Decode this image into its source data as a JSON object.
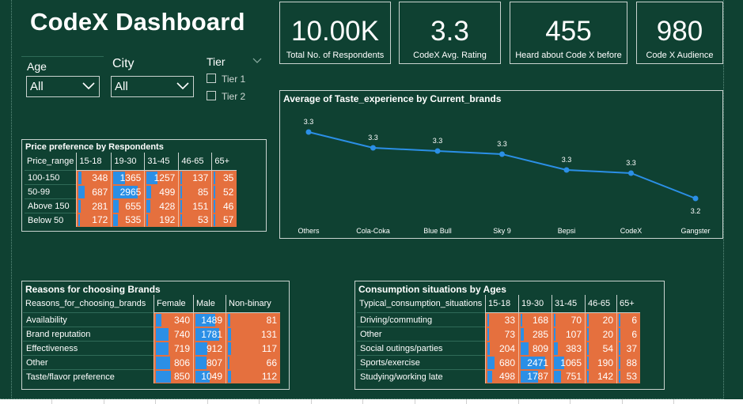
{
  "dashboard": {
    "title": "CodeX Dashboard"
  },
  "kpis": [
    {
      "value": "10.00K",
      "label": "Total No. of Respondents"
    },
    {
      "value": "3.3",
      "label": "CodeX Avg. Rating"
    },
    {
      "value": "455",
      "label": "Heard about Code X before"
    },
    {
      "value": "980",
      "label": "Code X Audience"
    }
  ],
  "filters": {
    "age": {
      "label": "Age",
      "selected": "All"
    },
    "city": {
      "label": "City",
      "selected": "All"
    },
    "tier": {
      "label": "Tier",
      "options": [
        "Tier 1",
        "Tier 2"
      ]
    }
  },
  "colors": {
    "background": "#0f4132",
    "cell_orange": "#e5703e",
    "bar_blue": "#2b8fe6",
    "line_blue": "#2b8fe6"
  },
  "price_table": {
    "title": "Price preference by Respondents",
    "columns": [
      "Price_range",
      "15-18",
      "19-30",
      "31-45",
      "46-65",
      "65+"
    ],
    "max": 2965,
    "rows": [
      {
        "label": "100-150",
        "values": [
          348,
          1365,
          1257,
          137,
          35
        ]
      },
      {
        "label": "50-99",
        "values": [
          687,
          2965,
          499,
          85,
          52
        ]
      },
      {
        "label": "Above 150",
        "values": [
          281,
          655,
          428,
          151,
          46
        ]
      },
      {
        "label": "Below 50",
        "values": [
          172,
          535,
          192,
          53,
          57
        ]
      }
    ]
  },
  "reasons_table": {
    "title": "Reasons for choosing Brands",
    "columns": [
      "Reasons_for_choosing_brands",
      "Female",
      "Male",
      "Non-binary"
    ],
    "max": 1781,
    "rows": [
      {
        "label": "Availability",
        "values": [
          340,
          1489,
          81
        ]
      },
      {
        "label": "Brand reputation",
        "values": [
          740,
          1781,
          131
        ]
      },
      {
        "label": "Effectiveness",
        "values": [
          719,
          912,
          117
        ]
      },
      {
        "label": "Other",
        "values": [
          806,
          807,
          66
        ]
      },
      {
        "label": "Taste/flavor preference",
        "values": [
          850,
          1049,
          112
        ]
      }
    ]
  },
  "consumption_table": {
    "title": "Consumption situations by Ages",
    "columns": [
      "Typical_consumption_situations",
      "15-18",
      "19-30",
      "31-45",
      "46-65",
      "65+"
    ],
    "max": 2471,
    "rows": [
      {
        "label": "Driving/commuting",
        "values": [
          33,
          168,
          70,
          20,
          6
        ]
      },
      {
        "label": "Other",
        "values": [
          73,
          285,
          107,
          20,
          6
        ]
      },
      {
        "label": "Social outings/parties",
        "values": [
          204,
          809,
          383,
          54,
          37
        ]
      },
      {
        "label": "Sports/exercise",
        "values": [
          680,
          2471,
          1065,
          190,
          88
        ]
      },
      {
        "label": "Studying/working late",
        "values": [
          498,
          1787,
          751,
          142,
          53
        ]
      }
    ]
  },
  "chart_data": {
    "type": "line",
    "title": "Average of Taste_experience by Current_brands",
    "categories": [
      "Others",
      "Cola-Coka",
      "Blue Bull",
      "Sky 9",
      "Bepsi",
      "CodeX",
      "Gangster"
    ],
    "values": [
      3.33,
      3.28,
      3.27,
      3.26,
      3.21,
      3.2,
      3.12
    ],
    "data_labels": [
      "3.3",
      "3.3",
      "3.3",
      "3.3",
      "3.3",
      "3.3",
      "3.2"
    ],
    "xlabel": "",
    "ylabel": "",
    "ylim": [
      3.1,
      3.35
    ],
    "grid": false,
    "color": "#2b8fe6"
  }
}
